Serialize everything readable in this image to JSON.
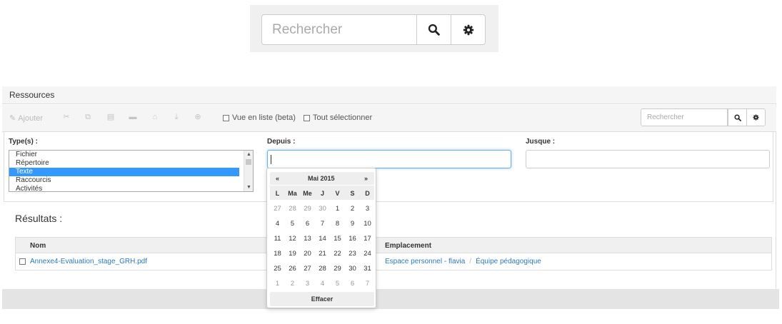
{
  "zoom_search": {
    "placeholder": "Rechercher"
  },
  "panel": {
    "title": "Ressources",
    "toolbar": {
      "add_label": "Ajouter",
      "list_view_label": "Vue en liste (beta)",
      "select_all_label": "Tout sélectionner",
      "search_placeholder": "Rechercher"
    },
    "filters": {
      "types_label": "Type(s) :",
      "types": [
        "Fichier",
        "Répertoire",
        "Texte",
        "Raccourcis",
        "Activités"
      ],
      "selected_type": "Texte",
      "from_label": "Depuis :",
      "to_label": "Jusque :"
    },
    "results": {
      "title": "Résultats :",
      "columns": {
        "name": "Nom",
        "location": "Emplacement"
      },
      "rows": [
        {
          "name": "Annexe4-Evaluation_stage_GRH.pdf",
          "location": [
            "Espace personnel - flavia",
            "Équipe pédagogique"
          ]
        }
      ]
    }
  },
  "datepicker": {
    "prev": "«",
    "month": "Mai 2015",
    "next": "»",
    "weekdays": [
      "L",
      "Ma",
      "Me",
      "J",
      "V",
      "S",
      "D"
    ],
    "weeks": [
      [
        "27",
        "28",
        "29",
        "30",
        "1",
        "2",
        "3"
      ],
      [
        "4",
        "5",
        "6",
        "7",
        "8",
        "9",
        "10"
      ],
      [
        "11",
        "12",
        "13",
        "14",
        "15",
        "16",
        "17"
      ],
      [
        "18",
        "19",
        "20",
        "21",
        "22",
        "23",
        "24"
      ],
      [
        "25",
        "26",
        "27",
        "28",
        "29",
        "30",
        "31"
      ],
      [
        "1",
        "2",
        "3",
        "4",
        "5",
        "6",
        "7"
      ]
    ],
    "clear_label": "Effacer"
  },
  "colors": {
    "accent": "#3399ff",
    "link": "#2a7ac0",
    "focus": "#66afe9"
  }
}
